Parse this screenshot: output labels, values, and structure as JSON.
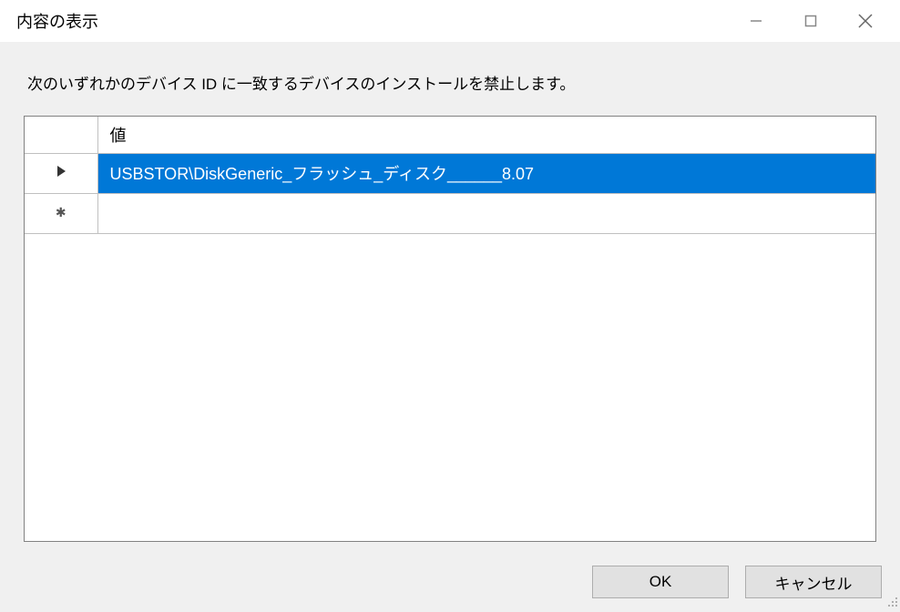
{
  "window": {
    "title": "内容の表示"
  },
  "description": "次のいずれかのデバイス ID に一致するデバイスのインストールを禁止します。",
  "grid": {
    "header": {
      "value_column": "値"
    },
    "rows": [
      {
        "indicator": "current",
        "value": "USBSTOR\\DiskGeneric_フラッシュ_ディスク______8.07",
        "selected": true
      },
      {
        "indicator": "new",
        "value": "",
        "selected": false
      }
    ]
  },
  "buttons": {
    "ok": "OK",
    "cancel": "キャンセル"
  }
}
